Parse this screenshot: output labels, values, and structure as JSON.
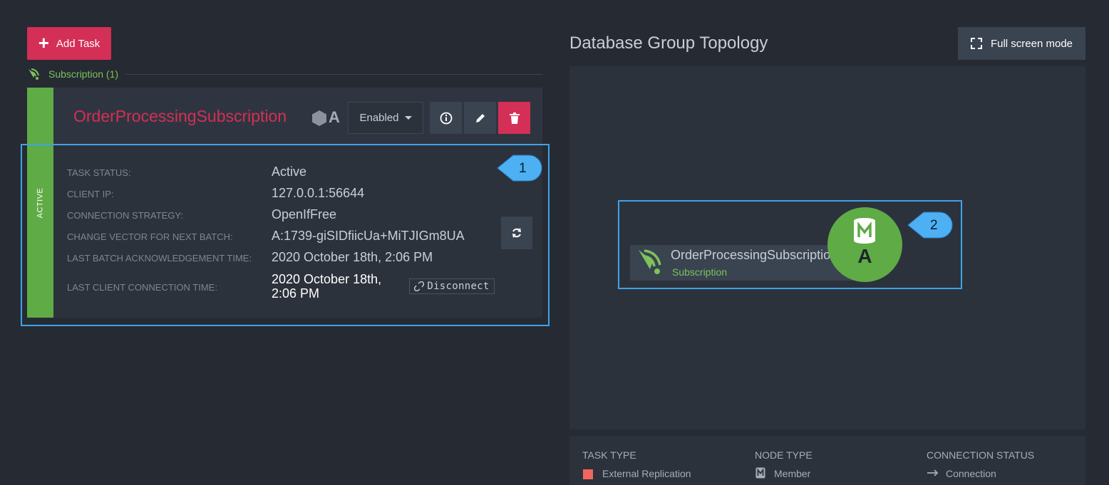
{
  "toolbar": {
    "add_task_label": "Add Task"
  },
  "subscriptions": {
    "header_label": "Subscription (1)"
  },
  "task": {
    "name": "OrderProcessingSubscription",
    "node_tag": "A",
    "state_dropdown": "Enabled",
    "status_strip": "ACTIVE",
    "details": [
      {
        "label": "TASK STATUS:",
        "value": "Active"
      },
      {
        "label": "CLIENT IP:",
        "value": "127.0.0.1:56644"
      },
      {
        "label": "CONNECTION STRATEGY:",
        "value": "OpenIfFree"
      },
      {
        "label": "CHANGE VECTOR FOR NEXT BATCH:",
        "value": "A:1739-giSIDfiicUa+MiTJIGm8UA"
      },
      {
        "label": "LAST BATCH ACKNOWLEDGEMENT TIME:",
        "value": "2020 October 18th, 2:06 PM"
      },
      {
        "label": "LAST CLIENT CONNECTION TIME:",
        "value_line1": "2020 October 18th,",
        "value_line2": "2:06 PM"
      }
    ],
    "disconnect_label": "Disconnect"
  },
  "callouts": {
    "one": "1",
    "two": "2"
  },
  "topology": {
    "title": "Database Group Topology",
    "fullscreen_label": "Full screen mode",
    "node_name": "OrderProcessingSubscription",
    "node_type": "Subscription",
    "member_tag": "A"
  },
  "legend": {
    "task_type_head": "TASK TYPE",
    "task_type_item": "External Replication",
    "node_type_head": "NODE TYPE",
    "node_type_item": "Member",
    "conn_status_head": "CONNECTION STATUS",
    "conn_status_item": "Connection"
  },
  "colors": {
    "background": "#262a33",
    "accent_red": "#d42f56",
    "active_green": "#5fab46",
    "subscription_green": "#7cc35b",
    "highlight_blue": "#3fa3e8",
    "legend_ext_replication": "#f0665e"
  },
  "icons": {
    "add": "plus-icon",
    "subscription": "subscription-rss-icon",
    "node": "hexagon-icon",
    "info": "info-icon",
    "edit": "pencil-icon",
    "delete": "trash-icon",
    "refresh": "refresh-icon",
    "disconnect": "broken-link-icon",
    "fullscreen": "expand-icon",
    "member": "database-member-icon",
    "connection": "arrow-right-icon"
  }
}
